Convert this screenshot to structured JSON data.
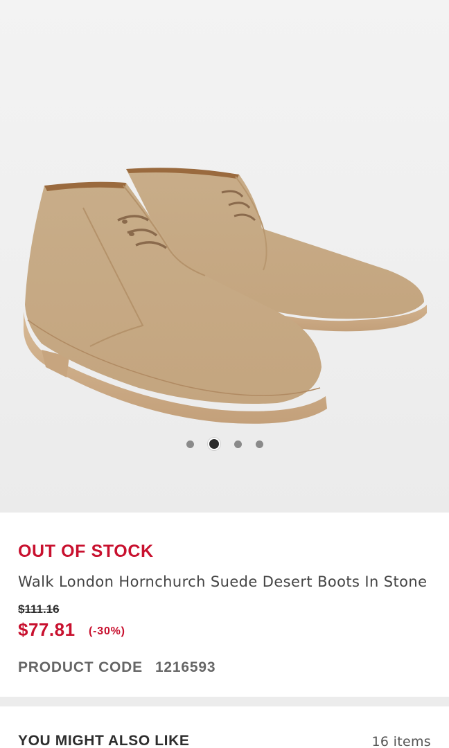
{
  "product": {
    "image_alt": "Walk London Hornchurch Suede Desert Boots In Stone",
    "stock_status": "OUT OF STOCK",
    "title": "Walk London Hornchurch Suede Desert Boots In Stone",
    "was_price": "$111.16",
    "price": "$77.81",
    "discount": "(-30%)",
    "code_label": "PRODUCT CODE",
    "code_value": "1216593"
  },
  "gallery": {
    "slide_count": 4,
    "active_index": 1
  },
  "recommendations": {
    "title": "YOU MIGHT ALSO LIKE",
    "count": "16 items"
  },
  "colors": {
    "sale_red": "#c8102e",
    "text_dark": "#2d2d2d",
    "suede": "#c9ad87"
  }
}
